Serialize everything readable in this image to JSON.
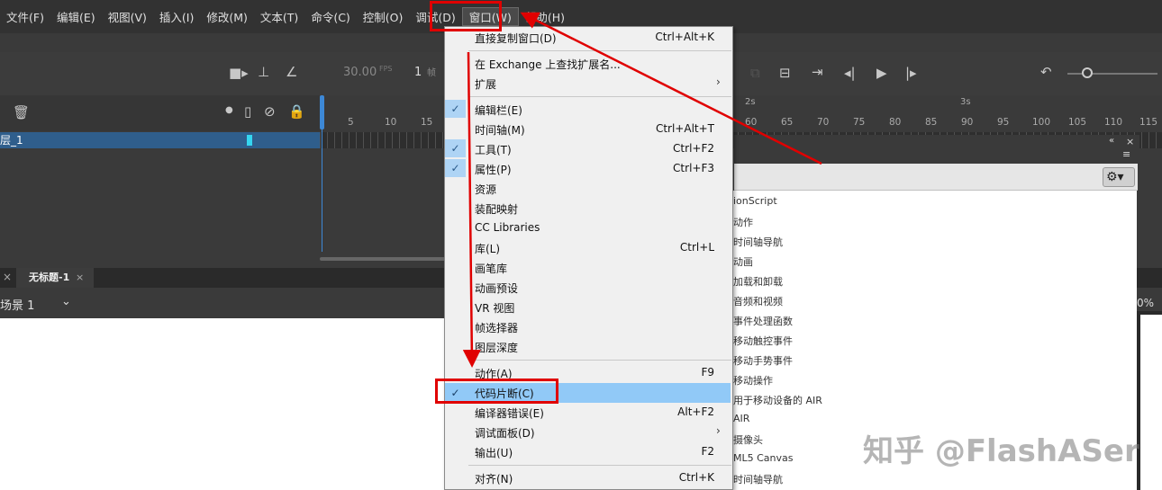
{
  "menubar": {
    "items": [
      {
        "label": "文件(F)"
      },
      {
        "label": "编辑(E)"
      },
      {
        "label": "视图(V)"
      },
      {
        "label": "插入(I)"
      },
      {
        "label": "修改(M)"
      },
      {
        "label": "文本(T)"
      },
      {
        "label": "命令(C)"
      },
      {
        "label": "控制(O)"
      },
      {
        "label": "调试(D)"
      },
      {
        "label": "窗口(W)"
      },
      {
        "label": "帮助(H)"
      }
    ]
  },
  "timeline": {
    "fps_value": "30.00",
    "fps_label": "FPS",
    "frame_number": "1",
    "frame_label": "帧",
    "layer_name": "层_1",
    "ruler_ticks": [
      "5",
      "10",
      "15",
      "60",
      "65",
      "70",
      "75",
      "80",
      "85",
      "90",
      "95",
      "100",
      "105",
      "110",
      "115"
    ],
    "second_markers": [
      "2s",
      "3s"
    ]
  },
  "doc_tab": {
    "title": "无标题-1",
    "close": "×",
    "prev_close": "×"
  },
  "scene": {
    "label": "场景 1"
  },
  "zoom": {
    "percent": "0%"
  },
  "dropdown": {
    "items": [
      {
        "label": "直接复制窗口(D)",
        "shortcut": "Ctrl+Alt+K"
      },
      {
        "label": "在 Exchange 上查找扩展名..."
      },
      {
        "label": "扩展"
      },
      {
        "label": "编辑栏(E)"
      },
      {
        "label": "时间轴(M)",
        "shortcut": "Ctrl+Alt+T"
      },
      {
        "label": "工具(T)",
        "shortcut": "Ctrl+F2"
      },
      {
        "label": "属性(P)",
        "shortcut": "Ctrl+F3"
      },
      {
        "label": "资源"
      },
      {
        "label": "装配映射"
      },
      {
        "label": "CC Libraries"
      },
      {
        "label": "库(L)",
        "shortcut": "Ctrl+L"
      },
      {
        "label": "画笔库"
      },
      {
        "label": "动画预设"
      },
      {
        "label": "VR 视图"
      },
      {
        "label": "帧选择器"
      },
      {
        "label": "图层深度"
      },
      {
        "label": "动作(A)",
        "shortcut": "F9"
      },
      {
        "label": "代码片断(C)"
      },
      {
        "label": "编译器错误(E)",
        "shortcut": "Alt+F2"
      },
      {
        "label": "调试面板(D)"
      },
      {
        "label": "输出(U)",
        "shortcut": "F2"
      },
      {
        "label": "对齐(N)",
        "shortcut": "Ctrl+K"
      }
    ],
    "check": "✓",
    "arrow": "›"
  },
  "snippets_panel": {
    "items": [
      "ionScript",
      "动作",
      "时间轴导航",
      "动画",
      "加载和卸载",
      "音频和视频",
      "事件处理函数",
      "移动触控事件",
      "移动手势事件",
      "移动操作",
      "用于移动设备的 AIR",
      "AIR",
      "摄像头",
      "ML5 Canvas",
      "时间轴导航"
    ],
    "panel_collapse": "«",
    "panel_close": "×",
    "panel_menu": "≡",
    "gear": "⚙▾"
  },
  "watermark": "知乎 @FlashASer",
  "colors": {
    "annotation_red": "#e00000",
    "highlight": "#91c9f7",
    "layer_selected": "#2f5e8c"
  }
}
